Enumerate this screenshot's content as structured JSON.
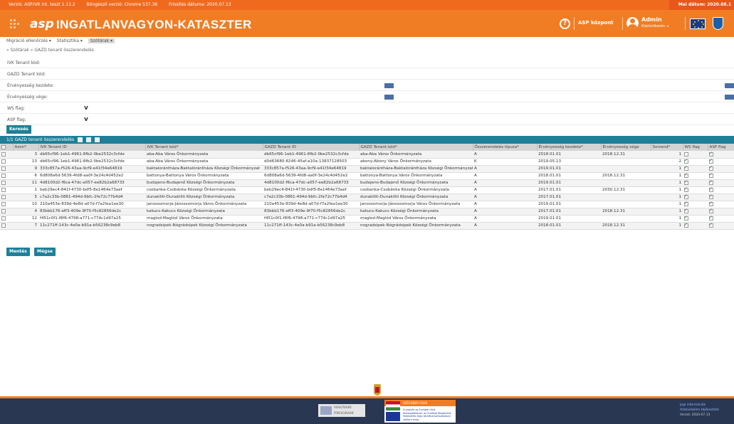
{
  "version_bar": {
    "version": "Verzió: ASP.IVK int. teszt 1.11.2",
    "browser": "Böngésző verzió: Chrome 537.36",
    "release": "Frissítés dátuma: 2020.07.13",
    "today": "Mai dátum: 2020.08.1"
  },
  "header": {
    "logo_asp": "asp",
    "title": "INGATLANVAGYON-KATASZTER",
    "help_icon": "?",
    "center": "ASP központ",
    "user": "Admin",
    "logout": "Kijelentkezés ⇒"
  },
  "nav": {
    "items": [
      "Migráció ellenőrzés ▾",
      "Statisztika ▾",
      "Szótárak ▾"
    ]
  },
  "breadcrumb": "» Szótárak » GAZD tenant összerendelés",
  "filters": {
    "ivk_tenant": "IVK Tenant kód:",
    "gazd_tenant": "GAZD Tenant kód:",
    "valid_from": "Érvényesség kezdete:",
    "valid_to": "Érvényesség vége:",
    "ws_flag": "WS flag:",
    "asp_flag": "ASP flag:",
    "chev": "v",
    "search_button": "Keresés"
  },
  "table": {
    "title": "1/1  GAZD tenant összerendelés",
    "columns": [
      "Azon*",
      "IVK Tenant ID",
      "IVK Tenant kód*",
      "GAZD Tenant ID",
      "GAZD Tenant kód*",
      "Összerendelés típusa*",
      "Érvényesség kezdete*",
      "Érvényesség vége",
      "Sorrend*",
      "WS flag",
      "ASP flag"
    ],
    "rows": [
      {
        "id": "3",
        "ivk_id": "db65cf96-1eb1-4961-8fb2-0be2532c3cfde",
        "ivk_kod": "aba-Aba Város Önkormányzata",
        "gazd_id": "db65cf96-1eb1-4961-8fb2-0be2532c3cfde",
        "gazd_kod": "aba-Aba Város Önkormányzata",
        "tipus": "A",
        "kezdet": "2018.01.01",
        "vege": "2018.12.31",
        "sorrend": "1",
        "ws": false,
        "asp": true
      },
      {
        "id": "13",
        "ivk_id": "db65cf96-1eb1-4961-8fb2-0be2532c3cfde",
        "ivk_kod": "aba-Aba Város Önkormányzata",
        "gazd_id": "d0d63680-8246-45af-a10a-13837128503",
        "gazd_kod": "abony-Abony Város Önkormányzata",
        "tipus": "K",
        "kezdet": "2019.05.13",
        "vege": "",
        "sorrend": "2",
        "ws": true,
        "asp": true
      },
      {
        "id": "9",
        "ivk_id": "333c857a-f526-43aa-9cf9-e41f34e64819",
        "ivk_kod": "baktalorántháza-Baktalórántháza Községi Önkormányzat",
        "gazd_id": "333c857a-f526-43aa-9cf9-e41f34e64819",
        "gazd_kod": "baktalorántháza-Baktalórántháza Községi Önkormányzat",
        "tipus": "A",
        "kezdet": "2019.01.01",
        "vege": "",
        "sorrend": "1",
        "ws": true,
        "asp": true
      },
      {
        "id": "6",
        "ivk_id": "6d808a6d-5639-4fd8-aa0f-3e24c4d452e2",
        "ivk_kod": "battonya-Battonya Város Önkormányzata",
        "gazd_id": "6d808a6d-5639-4fd8-aa0f-3e24c4d452e2",
        "gazd_kod": "battonya-Battonya Város Önkormányzata",
        "tipus": "A",
        "kezdet": "2018.01.01",
        "vege": "2018.12.31",
        "sorrend": "1",
        "ws": true,
        "asp": true
      },
      {
        "id": "11",
        "ivk_id": "4d8100d2-f6ca-47dc-a057-ee82b2a68733",
        "ivk_kod": "budajeno-Budajenő Községi Önkormányzata",
        "gazd_id": "4d8100d2-f6ca-47dc-a057-ee82b2a68733",
        "gazd_kod": "budajeno-Budajenő Községi Önkormányzata",
        "tipus": "A",
        "kezdet": "2019.01.01",
        "vege": "",
        "sorrend": "1",
        "ws": true,
        "asp": true
      },
      {
        "id": "1",
        "ivk_id": "beb29ec4-841f-4730-bdf5-8e1464e73aef",
        "ivk_kod": "csobanka-Csobánka Községi Önkormányzata",
        "gazd_id": "beb29ec4-841f-4730-bdf5-8e1464e73aef",
        "gazd_kod": "csobanka-Csobánka Községi Önkormányzata",
        "tipus": "A",
        "kezdet": "2017.01.01",
        "vege": "2030.12.31",
        "sorrend": "1",
        "ws": true,
        "asp": true
      },
      {
        "id": "5",
        "ivk_id": "c7a2c33b-0861-494d-9bfc-2fe72c77b4d4",
        "ivk_kod": "dunakiliti-Dunakiliti Községi Önkormányzata",
        "gazd_id": "c7a2c33b-0861-494d-9bfc-2fe72c77b4d4",
        "gazd_kod": "dunakiliti-Dunakiliti Községi Önkormányzata",
        "tipus": "A",
        "kezdet": "2017.01.01",
        "vege": "",
        "sorrend": "1",
        "ws": true,
        "asp": true
      },
      {
        "id": "10",
        "ivk_id": "210a453e-839d-4e8d-a07d-f7a2fea1ee30",
        "ivk_kod": "janossomorja-Jánossomorja Város Önkormányzata",
        "gazd_id": "210a453e-839d-4e8d-a07d-f7a2fea1ee30",
        "gazd_kod": "janossomorja-Jánossomorja Város Önkormányzata",
        "tipus": "A",
        "kezdet": "2019.01.01",
        "vege": "",
        "sorrend": "1",
        "ws": true,
        "asp": true
      },
      {
        "id": "4",
        "ivk_id": "83bbb176-eff3-409e-9f70-f5c82856de2c",
        "ivk_kod": "kakucs-Kakucs Községi Önkormányzata",
        "gazd_id": "83bbb176-eff3-409e-9f70-f5c82856de2c",
        "gazd_kod": "kakucs-Kakucs Községi Önkormányzata",
        "tipus": "A",
        "kezdet": "2017.01.01",
        "vege": "2018.12.31",
        "sorrend": "1",
        "ws": true,
        "asp": true
      },
      {
        "id": "12",
        "ivk_id": "f451c0f1-f8f6-4798-a771-c774c1d97a25",
        "ivk_kod": "maglod-Maglód Város Önkormányzata",
        "gazd_id": "f451c0f1-f8f6-4798-a771-c774c1d97a25",
        "gazd_kod": "maglod-Maglód Város Önkormányzata",
        "tipus": "A",
        "kezdet": "2019.01.01",
        "vege": "",
        "sorrend": "1",
        "ws": true,
        "asp": true
      },
      {
        "id": "7",
        "ivk_id": "11c271ff-143c-4e0a-b91a-b56238c9eb8",
        "ivk_kod": "nogradsipek-Nógrádsipek Községi Önkormányzata",
        "gazd_id": "11c271ff-143c-4e0a-b91a-b56238c9eb8",
        "gazd_kod": "nogradsipek-Nógrádsipek Községi Önkormányzata",
        "tipus": "A",
        "kezdet": "2018.01.01",
        "vege": "2018.12.31",
        "sorrend": "1",
        "ws": true,
        "asp": true
      }
    ]
  },
  "buttons": {
    "save": "Mentés",
    "cancel": "Mégse"
  },
  "footer": {
    "magyar_line1": "MAGYARI",
    "magyar_line2": "PROGRAM",
    "szechenyi": "SZÉCHENYI 2020",
    "eu_text": "A projekt az Európai Unió támogatásával, az Európai Regionális Fejlesztési Alap társfinanszírozásával valósul meg.",
    "right_line1": "Jogi információk",
    "right_line2": "Adatvédelmi tájékoztató",
    "right_line3": "Verzió: 2020.07.13"
  },
  "colors": {
    "orange": "#f07d24",
    "teal": "#1f7f98",
    "navy": "#2a3752"
  }
}
